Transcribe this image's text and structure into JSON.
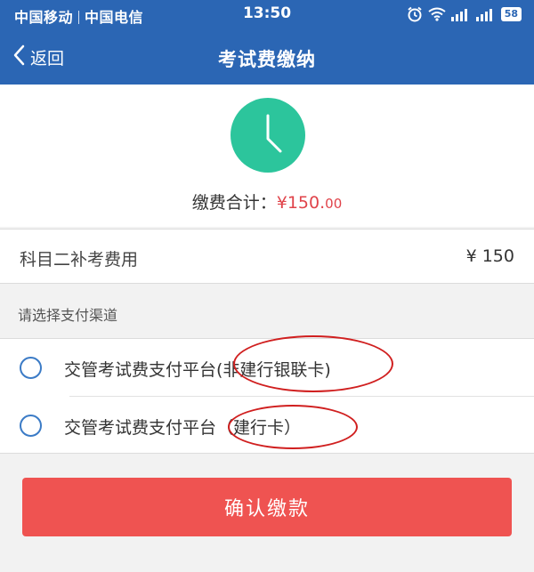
{
  "status_bar": {
    "carrier_1": "中国移动",
    "carrier_2": "中国电信",
    "time": "13:50",
    "battery": "58",
    "icons": [
      "alarm-icon",
      "wifi-icon",
      "signal-icon",
      "signal-icon",
      "battery-icon"
    ]
  },
  "nav": {
    "back_label": "返回",
    "title": "考试费缴纳"
  },
  "summary": {
    "icon": "clock-icon",
    "total_label": "缴费合计：",
    "total_amount": "¥150.",
    "total_cents": "00",
    "icon_color": "#2cc59c",
    "amount_color": "#e0434a"
  },
  "fee_item": {
    "name": "科目二补考费用",
    "price": "¥ 150"
  },
  "payment": {
    "section_label": "请选择支付渠道",
    "options": [
      {
        "label": "交管考试费支付平台(非建行银联卡)"
      },
      {
        "label": "交管考试费支付平台（建行卡）"
      }
    ]
  },
  "confirm": {
    "label": "确认缴款",
    "color": "#ef5351"
  },
  "theme": {
    "primary": "#2b66b4",
    "annotation": "#d01f1f"
  }
}
